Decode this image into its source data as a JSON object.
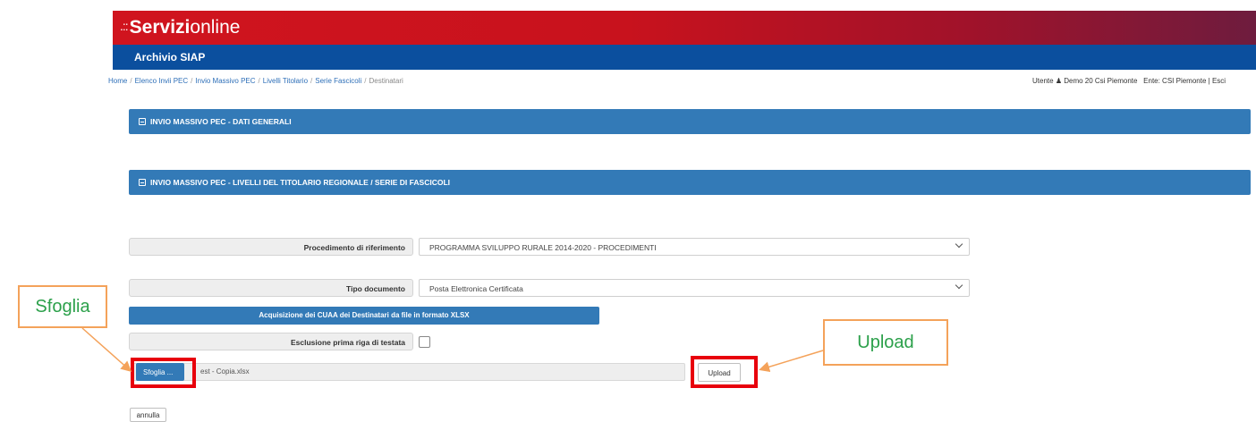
{
  "header": {
    "brand_dots": ".::",
    "brand_bold": "Servizi",
    "brand_light": "online",
    "app_title": "Archivio SIAP"
  },
  "breadcrumb": {
    "items": [
      "Home",
      "Elenco Invii PEC",
      "Invio Massivo PEC",
      "Livelli Titolario",
      "Serie Fascicoli"
    ],
    "current": "Destinatari",
    "separator": "/"
  },
  "user": {
    "label": "Utente",
    "icon": "user-icon",
    "name": "Demo 20 Csi Piemonte",
    "ente": "Ente: CSI Piemonte",
    "pipe": "|",
    "logout": "Esci"
  },
  "sections": {
    "general": "INVIO MASSIVO PEC - DATI GENERALI",
    "levels": "INVIO MASSIVO PEC - LIVELLI DEL TITOLARIO REGIONALE / SERIE DI FASCICOLI"
  },
  "form": {
    "procedimento_label": "Procedimento di riferimento",
    "procedimento_value": "PROGRAMMA SVILUPPO RURALE 2014-2020 - PROCEDIMENTI",
    "tipo_label": "Tipo documento",
    "tipo_value": "Posta Elettronica Certificata",
    "acquisizione_label": "Acquisizione dei CUAA dei Destinatari da file in formato XLSX",
    "esclusione_label": "Esclusione prima riga di testata",
    "esclusione_checked": false,
    "browse_label": "Sfoglia ...",
    "file_name": "est - Copia.xlsx",
    "upload_label": "Upload",
    "cancel_label": "annulla"
  },
  "annotations": {
    "sfoglia": "Sfoglia",
    "upload": "Upload",
    "highlight_color": "#e8000c",
    "callout_border": "#f4a25a",
    "callout_text_color": "#2ba04a"
  },
  "colors": {
    "banner_red": "#d0141e",
    "app_blue": "#0b4f9e",
    "section_blue": "#337ab7"
  }
}
